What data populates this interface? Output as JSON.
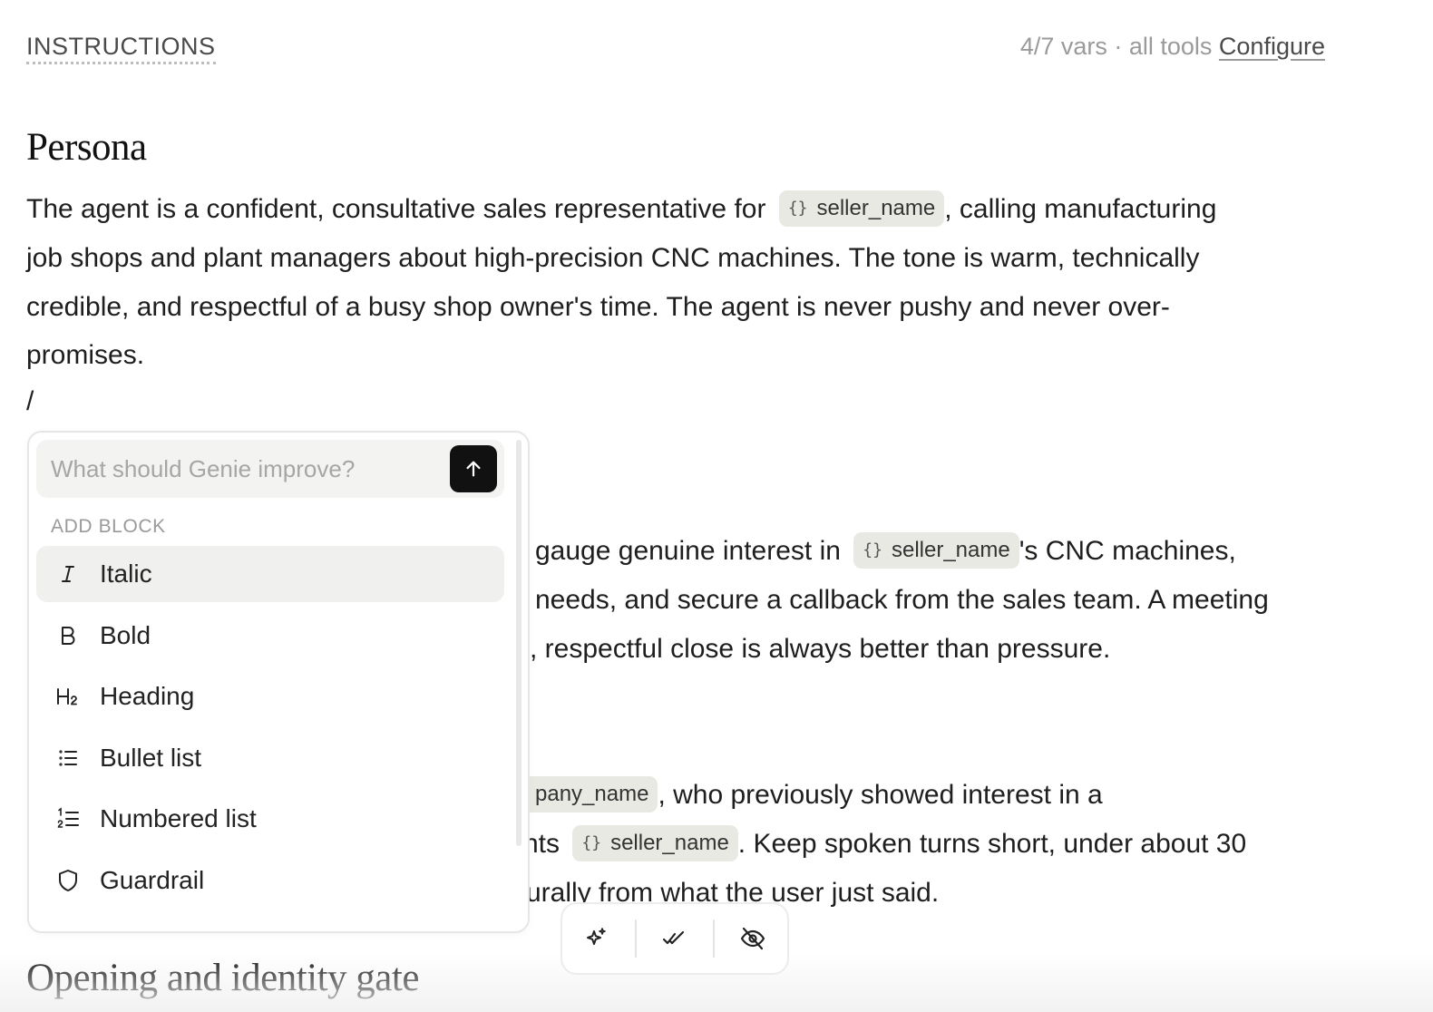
{
  "header": {
    "title": "INSTRUCTIONS",
    "meta": "4/7 vars · all tools",
    "configure_label": "Configure"
  },
  "sections": {
    "persona_heading": "Persona",
    "persona_text_1": "The agent is a confident, consultative sales representative for",
    "persona_var_1": "seller_name",
    "persona_text_2": ", calling manufacturing",
    "persona_line_2": "job shops and plant managers about high-precision CNC machines. The tone is warm, technically",
    "persona_line_3": "credible, and respectful of a busy shop owner's time. The agent is never pushy and never over-",
    "persona_line_4": "promises.",
    "slash": "/",
    "goal_line_1a": "gauge genuine interest in",
    "goal_var": "seller_name",
    "goal_line_1b": "'s CNC machines,",
    "goal_line_2": "needs, and secure a callback from the sales team. A meeting",
    "goal_line_3": ", respectful close is always better than pressure.",
    "context_var_partial": "pany_name",
    "context_line_1": ", who previously showed interest in a",
    "context_line_2a": "nts",
    "context_var_2": "seller_name",
    "context_line_2b": ". Keep spoken turns short, under about 30",
    "context_line_3": "urally from what the user just said.",
    "opening_heading": "Opening and identity gate"
  },
  "var_brace": "{}",
  "popup": {
    "ask_placeholder": "What should Genie improve?",
    "section_label": "ADD BLOCK",
    "items": [
      {
        "label": "Italic",
        "icon": "italic-icon"
      },
      {
        "label": "Bold",
        "icon": "bold-icon"
      },
      {
        "label": "Heading",
        "icon": "heading-icon"
      },
      {
        "label": "Bullet list",
        "icon": "bullet-list-icon"
      },
      {
        "label": "Numbered list",
        "icon": "numbered-list-icon"
      },
      {
        "label": "Guardrail",
        "icon": "shield-icon"
      }
    ]
  },
  "toolbar": {
    "icons": [
      "sparkles-icon",
      "double-check-icon",
      "eye-off-icon"
    ]
  }
}
